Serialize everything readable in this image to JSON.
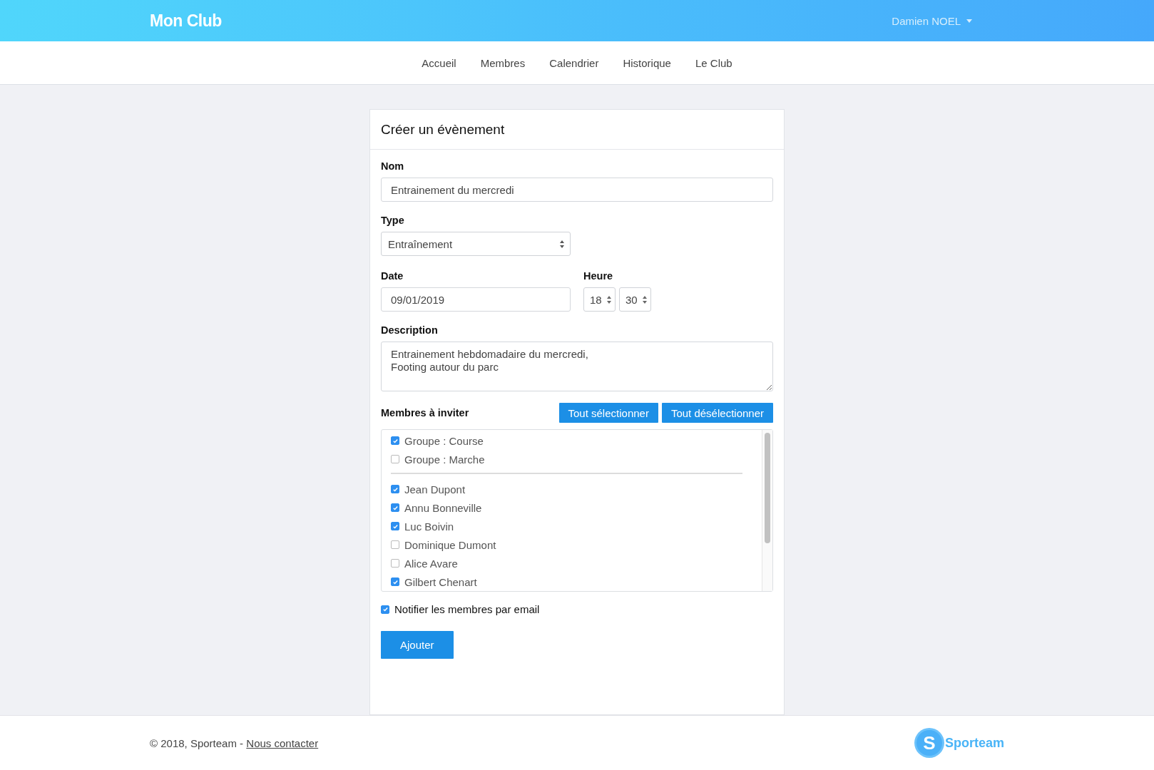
{
  "header": {
    "brand": "Mon Club",
    "user_menu": "Damien NOEL"
  },
  "nav": [
    {
      "label": "Accueil"
    },
    {
      "label": "Membres"
    },
    {
      "label": "Calendrier"
    },
    {
      "label": "Historique"
    },
    {
      "label": "Le Club"
    }
  ],
  "form": {
    "title": "Créer un évènement",
    "name": {
      "label": "Nom",
      "value": "Entrainement du mercredi"
    },
    "type": {
      "label": "Type",
      "value": "Entraînement"
    },
    "date": {
      "label": "Date",
      "value": "09/01/2019"
    },
    "time": {
      "label": "Heure",
      "hour": "18",
      "minute": "30"
    },
    "description": {
      "label": "Description",
      "value": "Entrainement hebdomadaire du mercredi,\nFooting autour du parc"
    },
    "members": {
      "label": "Membres à inviter",
      "select_all": "Tout sélectionner",
      "deselect_all": "Tout désélectionner",
      "groups": [
        {
          "label": "Groupe : Course",
          "checked": true
        },
        {
          "label": "Groupe : Marche",
          "checked": false
        }
      ],
      "people": [
        {
          "label": "Jean Dupont",
          "checked": true
        },
        {
          "label": "Annu Bonneville",
          "checked": true
        },
        {
          "label": "Luc Boivin",
          "checked": true
        },
        {
          "label": "Dominique Dumont",
          "checked": false
        },
        {
          "label": "Alice Avare",
          "checked": false
        },
        {
          "label": "Gilbert Chenart",
          "checked": true
        }
      ]
    },
    "notify": {
      "label": "Notifier les membres par email",
      "checked": true
    },
    "submit": "Ajouter"
  },
  "footer": {
    "copyright": "© 2018, Sporteam - ",
    "contact_link": "Nous contacter",
    "logo_letter": "S",
    "logo_text": "Sporteam"
  }
}
